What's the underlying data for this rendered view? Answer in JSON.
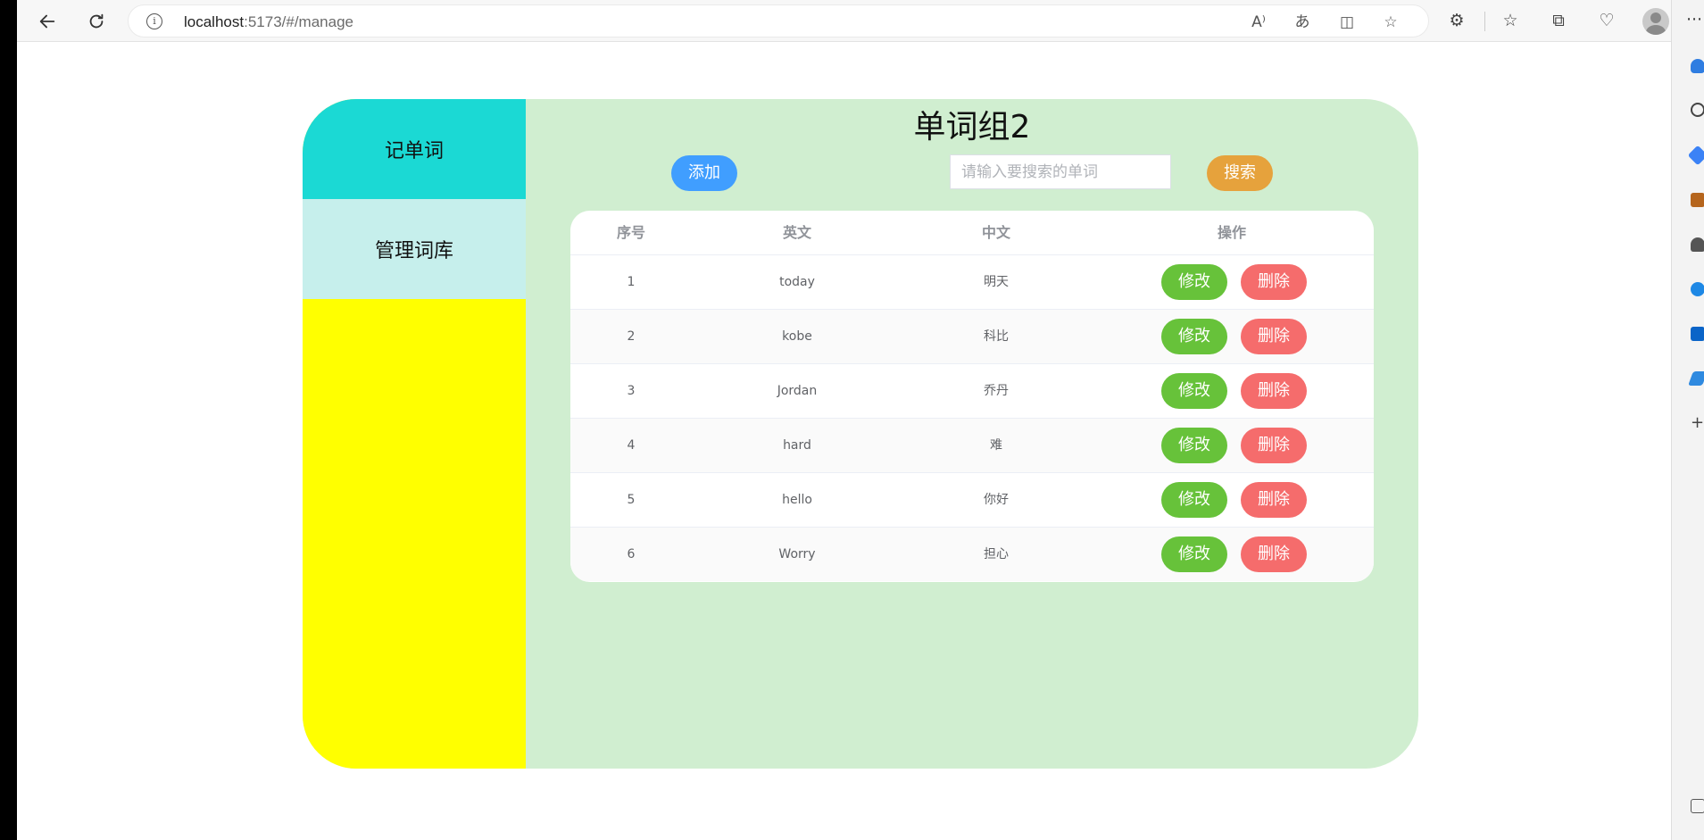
{
  "browser": {
    "url_host": "localhost",
    "url_rest": ":5173/#/manage"
  },
  "sidebar": {
    "items": [
      {
        "label": "记单词"
      },
      {
        "label": "管理词库"
      }
    ]
  },
  "main": {
    "title": "单词组2",
    "add_label": "添加",
    "search_placeholder": "请输入要搜索的单词",
    "search_value": "",
    "search_label": "搜索"
  },
  "table": {
    "headers": [
      "序号",
      "英文",
      "中文",
      "操作"
    ],
    "rows": [
      {
        "idx": "1",
        "en": "today",
        "cn": "明天"
      },
      {
        "idx": "2",
        "en": "kobe",
        "cn": "科比"
      },
      {
        "idx": "3",
        "en": "Jordan",
        "cn": "乔丹"
      },
      {
        "idx": "4",
        "en": "hard",
        "cn": "难"
      },
      {
        "idx": "5",
        "en": "hello",
        "cn": "你好"
      },
      {
        "idx": "6",
        "en": "Worry",
        "cn": "担心"
      }
    ],
    "edit_label": "修改",
    "delete_label": "删除"
  },
  "colors": {
    "nav_active": "#1bd9d4",
    "nav_inactive": "#c6efec",
    "sidebar_bg": "#ffff00",
    "main_bg": "#d0eed0",
    "add": "#409eff",
    "search": "#e6a23c",
    "edit": "#67c23a",
    "delete": "#f56c6c"
  }
}
